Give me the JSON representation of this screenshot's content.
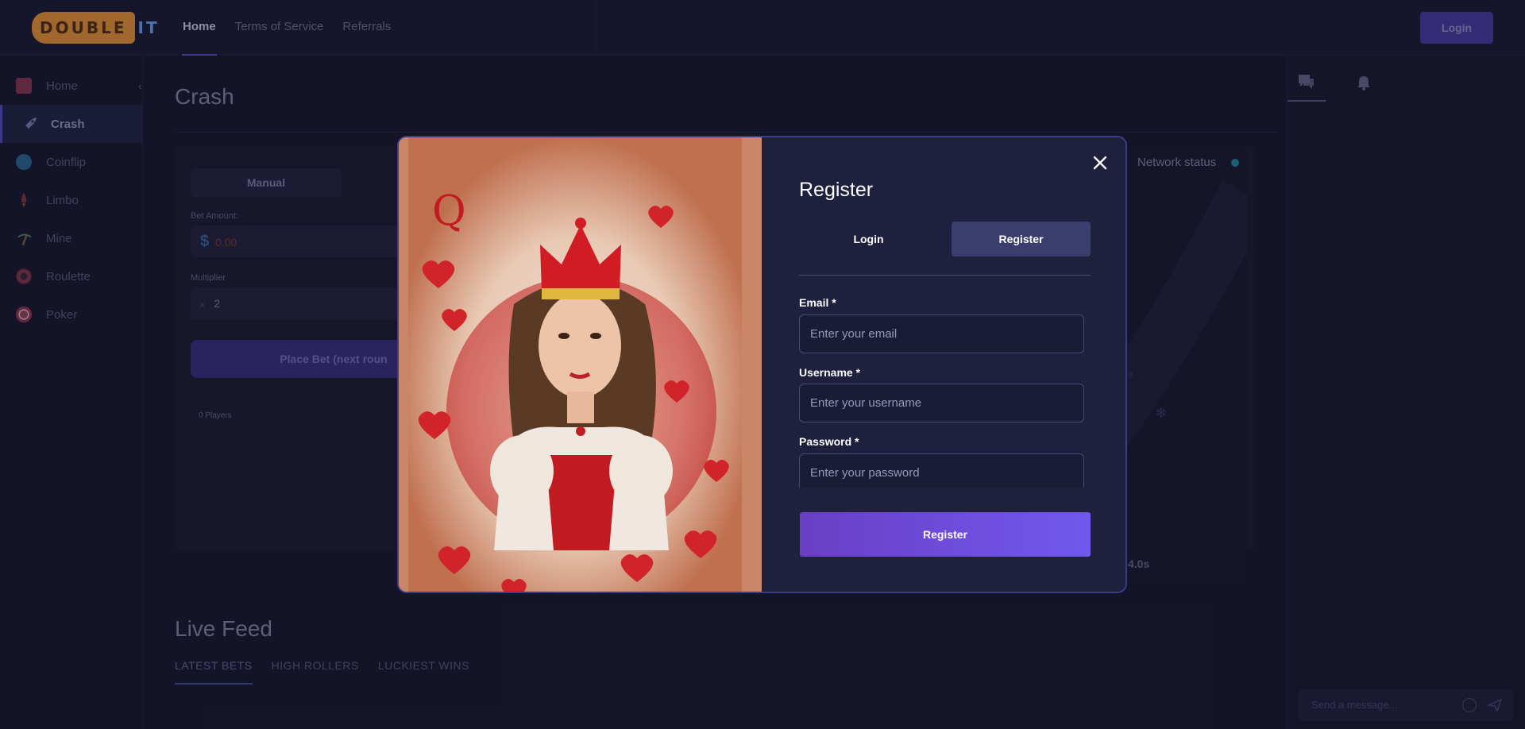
{
  "header": {
    "logo_left": "DOUBLE",
    "logo_right": "IT",
    "nav": [
      "Home",
      "Terms of Service",
      "Referrals"
    ],
    "login_label": "Login"
  },
  "sidebar": {
    "items": [
      {
        "label": "Home",
        "icon": "home-icon",
        "color": "#e04b6a"
      },
      {
        "label": "Crash",
        "icon": "rocket-icon",
        "color": "#9aa7d8"
      },
      {
        "label": "Coinflip",
        "icon": "coin-icon",
        "color": "#3f9fd8"
      },
      {
        "label": "Limbo",
        "icon": "rocket-icon",
        "color": "#d84a5a"
      },
      {
        "label": "Mine",
        "icon": "pickaxe-icon",
        "color": "#7dc08a"
      },
      {
        "label": "Roulette",
        "icon": "roulette-icon",
        "color": "#d84a6a"
      },
      {
        "label": "Poker",
        "icon": "chip-icon",
        "color": "#e0506a"
      }
    ],
    "active_index": 1,
    "collapse_glyph": "‹"
  },
  "crash": {
    "title": "Crash",
    "mode_tab": "Manual",
    "bet_amount_label": "Bet Amount:",
    "bet_currency": "$",
    "bet_placeholder": "0.00",
    "multiplier_label": "Multiplier",
    "multiplier_prefix": "x",
    "multiplier_value": "2",
    "place_bet_label": "Place Bet (next roun",
    "players": "0 Players",
    "network_status": "Network status",
    "timer": "4.0s"
  },
  "live_feed": {
    "title": "Live Feed",
    "tabs": [
      "LATEST BETS",
      "HIGH ROLLERS",
      "LUCKIEST WINS"
    ]
  },
  "right_panel": {
    "chat_placeholder": "Send a message..."
  },
  "modal": {
    "title": "Register",
    "tabs": [
      "Login",
      "Register"
    ],
    "email_label": "Email",
    "email_placeholder": "Enter your email",
    "username_label": "Username",
    "username_placeholder": "Enter your username",
    "password_label": "Password",
    "password_placeholder": "Enter your password",
    "required_mark": "*",
    "submit_label": "Register",
    "card_letter": "Q"
  },
  "colors": {
    "accent": "#6c4fe0",
    "background": "#1a1b30",
    "modal_bg": "#1f1f3e"
  }
}
